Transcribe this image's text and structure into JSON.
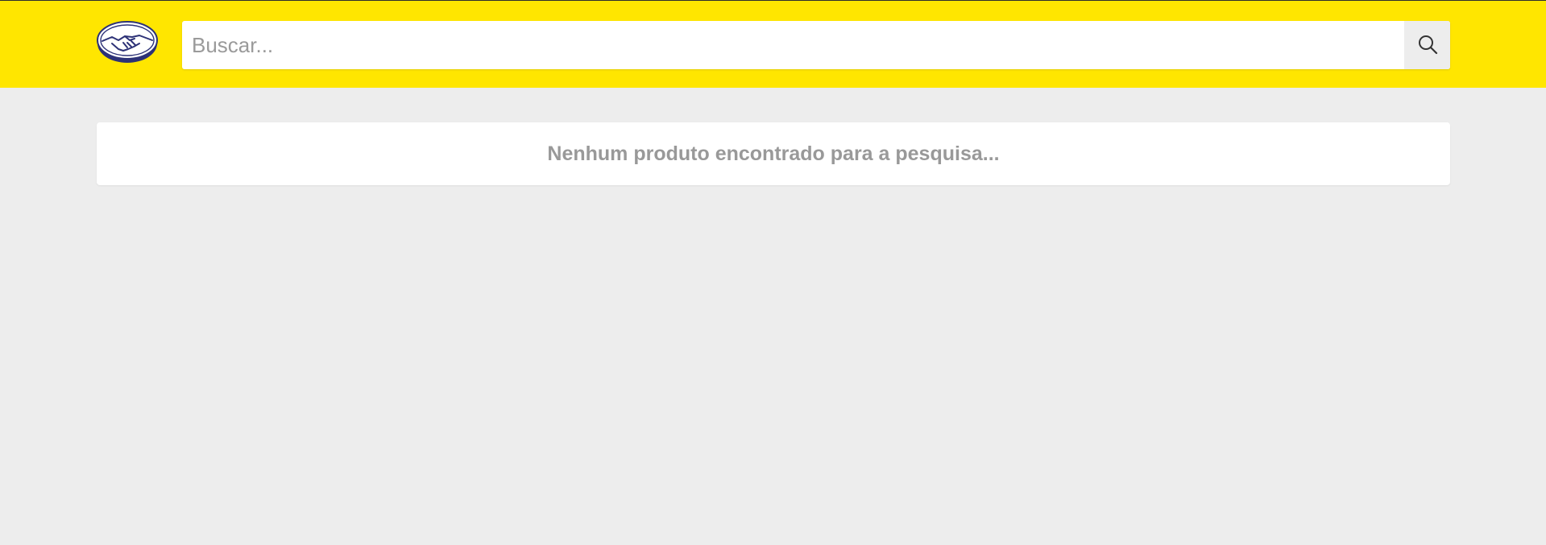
{
  "header": {
    "logo_icon": "mercadolivre-handshake-logo-icon",
    "background_color": "#ffe600"
  },
  "search": {
    "value": "",
    "placeholder": "Buscar...",
    "button_icon": "search-icon"
  },
  "results": {
    "empty_message": "Nenhum produto encontrado para a pesquisa..."
  },
  "colors": {
    "page_background": "#ededed",
    "message_text": "#999999"
  }
}
